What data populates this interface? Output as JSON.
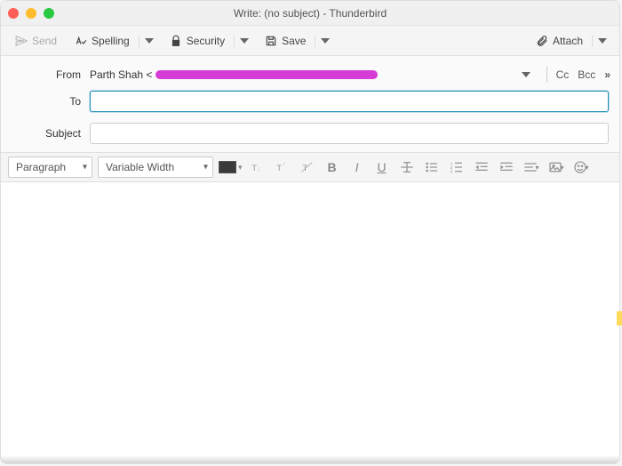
{
  "window": {
    "title": "Write: (no subject) - Thunderbird"
  },
  "toolbar": {
    "send": "Send",
    "spelling": "Spelling",
    "security": "Security",
    "save": "Save",
    "attach": "Attach"
  },
  "address": {
    "from_label": "From",
    "from_name": "Parth Shah <",
    "to_label": "To",
    "to_value": "",
    "subject_label": "Subject",
    "subject_value": "",
    "cc": "Cc",
    "bcc": "Bcc"
  },
  "format": {
    "paragraph": "Paragraph",
    "font": "Variable Width"
  }
}
